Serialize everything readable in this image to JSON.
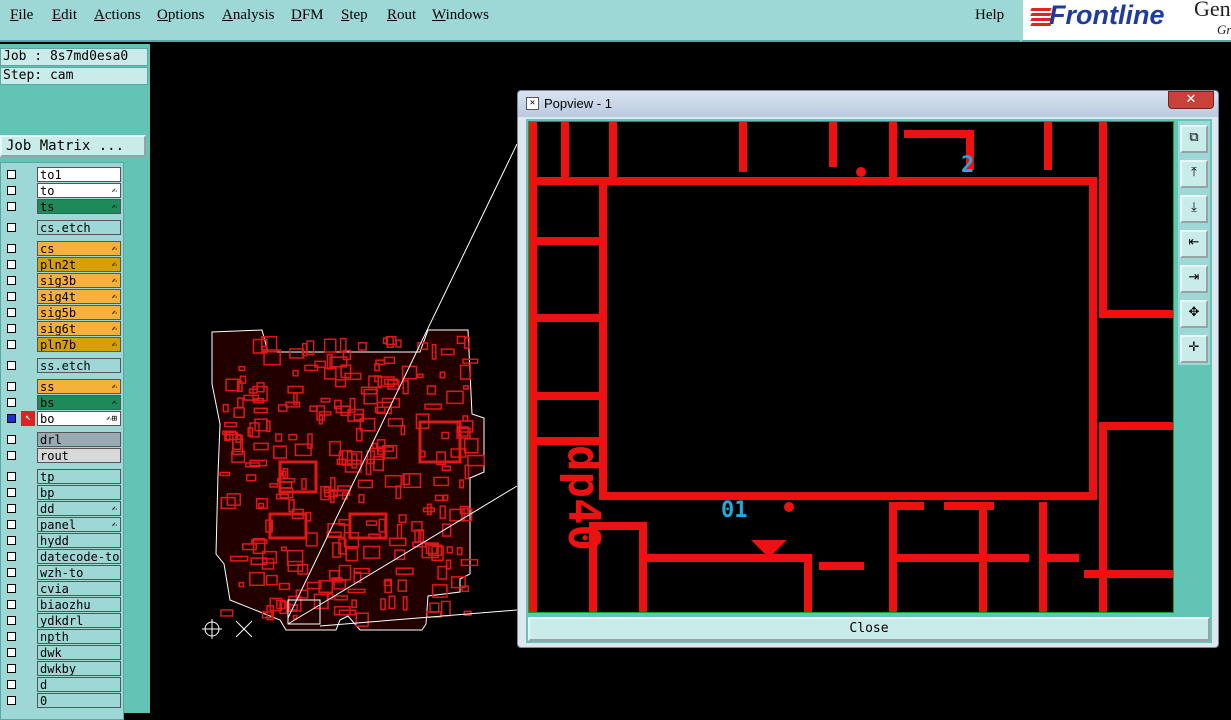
{
  "menu": {
    "items": [
      "File",
      "Edit",
      "Actions",
      "Options",
      "Analysis",
      "DFM",
      "Step",
      "Rout",
      "Windows"
    ],
    "help": "Help"
  },
  "logo": {
    "brand": "Frontline",
    "gen": "Gen",
    "gr": "Gr"
  },
  "job": {
    "label": "Job : 8s7md0esa0",
    "step": "Step: cam",
    "matrix": "Job Matrix ..."
  },
  "layers": [
    {
      "name": "to1",
      "color": "#ffffff",
      "flag": ""
    },
    {
      "name": "to",
      "color": "#ffffff",
      "flag": "✍"
    },
    {
      "name": "ts",
      "color": "#1e8a5a",
      "flag": "✍"
    },
    {
      "name": "cs.etch",
      "color": "#9ed8d6",
      "flag": "",
      "gap": true
    },
    {
      "name": "cs",
      "color": "#f5b13a",
      "flag": "✍",
      "gap": true
    },
    {
      "name": "pln2t",
      "color": "#d6a000",
      "flag": "✍"
    },
    {
      "name": "sig3b",
      "color": "#f5b13a",
      "flag": "✍"
    },
    {
      "name": "sig4t",
      "color": "#f5b13a",
      "flag": "✍"
    },
    {
      "name": "sig5b",
      "color": "#f5b13a",
      "flag": "✍"
    },
    {
      "name": "sig6t",
      "color": "#f5b13a",
      "flag": "✍"
    },
    {
      "name": "pln7b",
      "color": "#d6a000",
      "flag": "✍"
    },
    {
      "name": "ss.etch",
      "color": "#9ed8d6",
      "flag": "",
      "gap": true
    },
    {
      "name": "ss",
      "color": "#f5b13a",
      "flag": "✍",
      "gap": true
    },
    {
      "name": "bs",
      "color": "#1e8a5a",
      "flag": "✍"
    },
    {
      "name": "bo",
      "color": "#ffffff",
      "flag": "✍⊞",
      "active": true
    },
    {
      "name": "drl",
      "color": "#9aaab2",
      "flag": "",
      "gap": true
    },
    {
      "name": "rout",
      "color": "#d8d8d8",
      "flag": ""
    },
    {
      "name": "tp",
      "color": "#9ed8d6",
      "flag": "",
      "gap": true
    },
    {
      "name": "bp",
      "color": "#9ed8d6",
      "flag": ""
    },
    {
      "name": "dd",
      "color": "#9ed8d6",
      "flag": "✍"
    },
    {
      "name": "panel",
      "color": "#9ed8d6",
      "flag": "✍"
    },
    {
      "name": "hydd",
      "color": "#9ed8d6",
      "flag": ""
    },
    {
      "name": "datecode-to",
      "color": "#9ed8d6",
      "flag": ""
    },
    {
      "name": "wzh-to",
      "color": "#9ed8d6",
      "flag": ""
    },
    {
      "name": "cvia",
      "color": "#9ed8d6",
      "flag": ""
    },
    {
      "name": "biaozhu",
      "color": "#9ed8d6",
      "flag": ""
    },
    {
      "name": "ydkdrl",
      "color": "#9ed8d6",
      "flag": ""
    },
    {
      "name": "npth",
      "color": "#9ed8d6",
      "flag": ""
    },
    {
      "name": "dwk",
      "color": "#9ed8d6",
      "flag": ""
    },
    {
      "name": "dwkby",
      "color": "#9ed8d6",
      "flag": ""
    },
    {
      "name": "d",
      "color": "#9ed8d6",
      "flag": ""
    },
    {
      "name": "0",
      "color": "#9ed8d6",
      "flag": ""
    }
  ],
  "popview": {
    "title": "Popview - 1",
    "close_x": "✕",
    "close_label": "Close",
    "tools": [
      "zoom-page-icon",
      "pan-up-icon",
      "pan-down-icon",
      "pan-left-icon",
      "pan-right-icon",
      "zoom-out-icon",
      "zoom-in-icon"
    ],
    "labels": {
      "top": "2",
      "bottom": "01",
      "side": "dp40"
    }
  }
}
